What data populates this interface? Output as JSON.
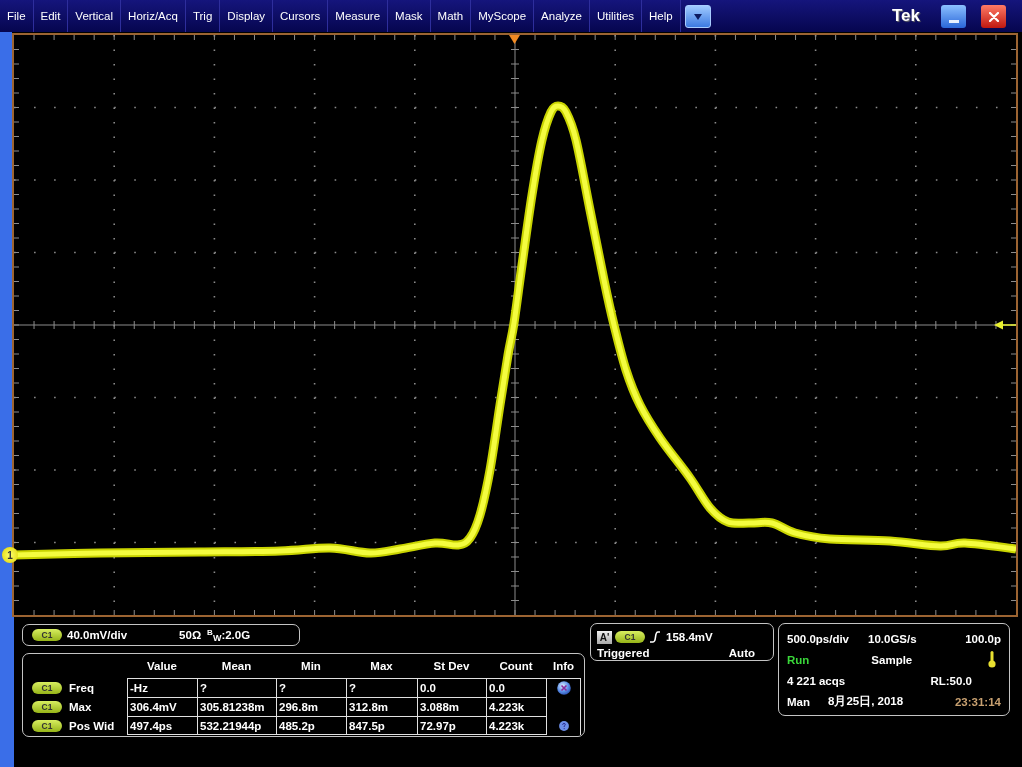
{
  "menu_bar": {
    "items": [
      "File",
      "Edit",
      "Vertical",
      "Horiz/Acq",
      "Trig",
      "Display",
      "Cursors",
      "Measure",
      "Mask",
      "Math",
      "MyScope",
      "Analyze",
      "Utilities",
      "Help"
    ],
    "brand": "Tek"
  },
  "display": {
    "channel_marker": "1"
  },
  "channel_panel": {
    "badge": "C1",
    "scale": "40.0mV/div",
    "termination": "50Ω",
    "bandwidth": "$^{B}$$_{W}$:2.0G"
  },
  "measurements": {
    "columns": [
      "Value",
      "Mean",
      "Min",
      "Max",
      "St Dev",
      "Count",
      "Info"
    ],
    "rows": [
      {
        "badge": "C1",
        "name": "Freq",
        "cells": [
          "-Hz",
          "?",
          "?",
          "?",
          "0.0",
          "0.0"
        ],
        "info": {
          "kind": "error"
        }
      },
      {
        "badge": "C1",
        "name": "Max",
        "cells": [
          "306.4mV",
          "305.81238m",
          "296.8m",
          "312.8m",
          "3.088m",
          "4.223k"
        ]
      },
      {
        "badge": "C1",
        "name": "Pos Wid",
        "cells": [
          "497.4ps",
          "532.21944p",
          "485.2p",
          "847.5p",
          "72.97p",
          "4.223k"
        ],
        "info": {
          "kind": "help"
        }
      }
    ]
  },
  "trigger_panel": {
    "source": "A'",
    "badge": "C1",
    "rising_edge": true,
    "level": "158.4mV",
    "status": "Triggered",
    "mode": "Auto"
  },
  "acquisition_panel": {
    "scale": "500.0ps/div",
    "sample_rate": "10.0GS/s",
    "position": "100.0p",
    "running": true,
    "run_state": "Run",
    "acquisition_mode": "Sample",
    "acquisitions": "4 221 acqs",
    "record_length": "RL:50.0",
    "time_mode": "Man",
    "date": "8月25日, 2018",
    "time": "23:31:14"
  }
}
